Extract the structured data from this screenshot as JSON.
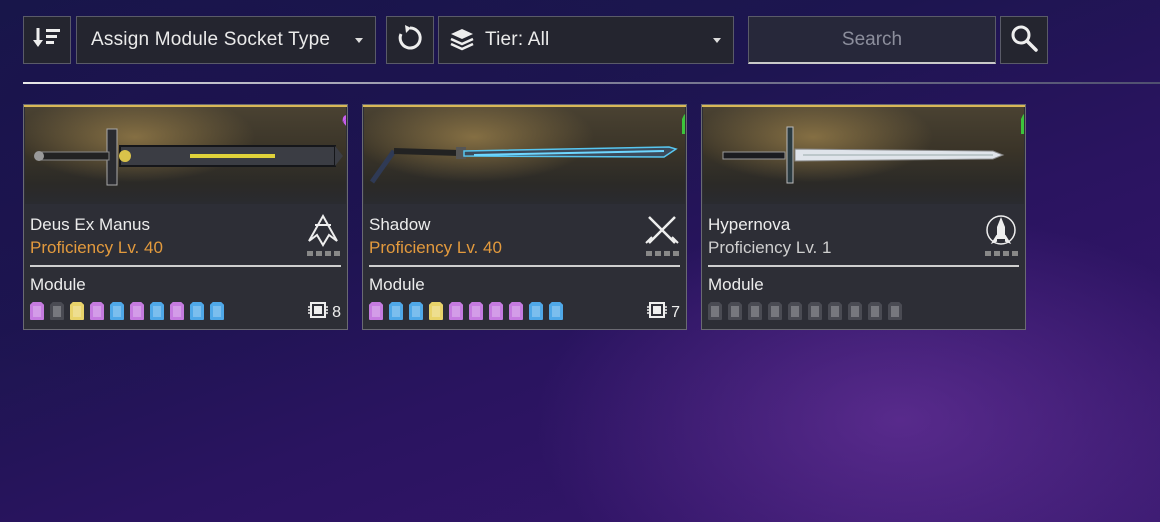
{
  "toolbar": {
    "sort_icon": "sort-descending-icon",
    "socket_dropdown_label": "Assign Module Socket Type",
    "refresh_icon": "refresh-icon",
    "tier_icon": "layers-icon",
    "tier_dropdown_label": "Tier: All",
    "search_placeholder": "Search",
    "search_icon": "search-icon"
  },
  "colors": {
    "accent_gold": "#d9b857",
    "proficiency_orange": "#e39a3d",
    "proficiency_grey": "#cfcfcf",
    "socket_purple": "#c57be0",
    "socket_blue": "#4fa8e8",
    "socket_yellow": "#e8d36a",
    "socket_empty": "#4a4b53"
  },
  "weapons": [
    {
      "name": "Deus Ex Manus",
      "proficiency": "Proficiency Lv. 40",
      "proficiency_color": "#e39a3d",
      "module_label": "Module",
      "badge_icon": "ammo-special-icon",
      "emblem_icon": "weapon-class-emblem-icon",
      "capacity": "8",
      "sockets": [
        "purple",
        "empty",
        "yellow",
        "purple",
        "blue",
        "purple",
        "blue",
        "purple",
        "blue",
        "blue"
      ]
    },
    {
      "name": "Shadow",
      "proficiency": "Proficiency Lv. 40",
      "proficiency_color": "#e39a3d",
      "module_label": "Module",
      "badge_icon": "ammo-general-icon",
      "emblem_icon": "crossed-swords-emblem-icon",
      "capacity": "7",
      "sockets": [
        "purple",
        "blue",
        "blue",
        "yellow",
        "purple",
        "purple",
        "purple",
        "purple",
        "blue",
        "blue"
      ]
    },
    {
      "name": "Hypernova",
      "proficiency": "Proficiency Lv. 1",
      "proficiency_color": "#cfcfcf",
      "module_label": "Module",
      "badge_icon": "ammo-general-icon",
      "emblem_icon": "rocket-emblem-icon",
      "capacity": "",
      "sockets": [
        "empty",
        "empty",
        "empty",
        "empty",
        "empty",
        "empty",
        "empty",
        "empty",
        "empty",
        "empty"
      ]
    }
  ]
}
